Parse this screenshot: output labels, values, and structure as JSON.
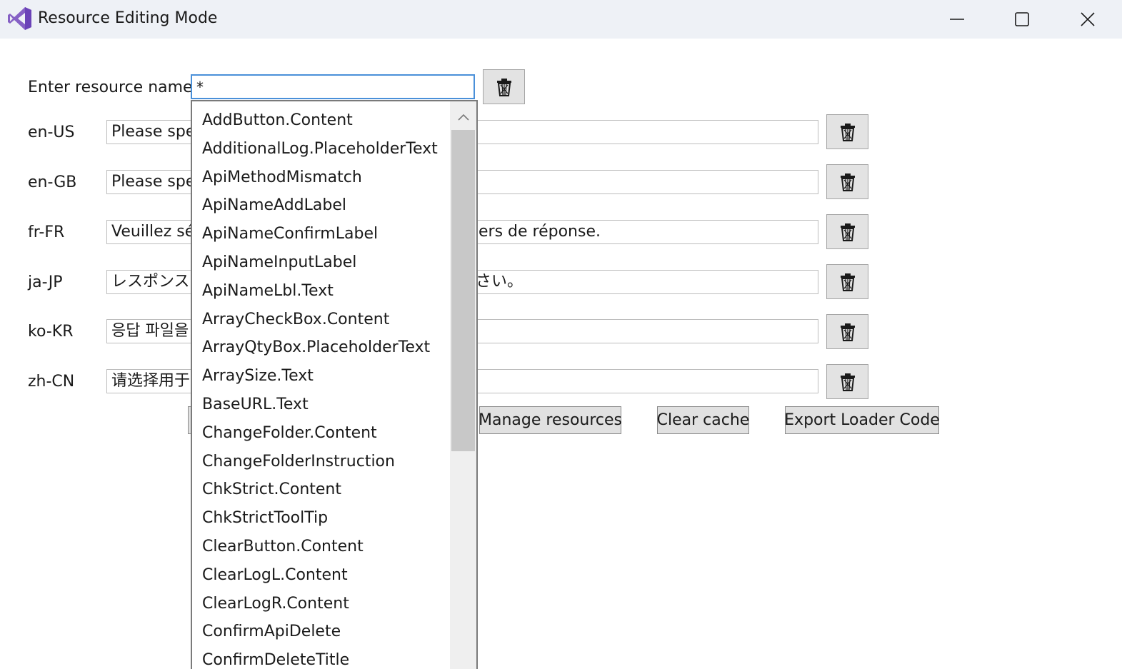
{
  "window": {
    "title": "Resource Editing Mode",
    "icons": {
      "app": "visual-studio-logo",
      "minimize": "minimize-icon",
      "maximize": "maximize-icon",
      "close": "close-icon"
    }
  },
  "form": {
    "resource_label": "Enter resource name",
    "resource_input_value": "*",
    "rows": [
      {
        "locale": "en-US",
        "left_text": "Please spe",
        "right_text": ""
      },
      {
        "locale": "en-GB",
        "left_text": "Please spe",
        "right_text": ""
      },
      {
        "locale": "fr-FR",
        "left_text": "Veuillez sé",
        "right_text": "ers de réponse."
      },
      {
        "locale": "ja-JP",
        "left_text": "レスポンスフ",
        "right_text": "さい。"
      },
      {
        "locale": "ko-KR",
        "left_text": "응답 파일을",
        "right_text": ""
      },
      {
        "locale": "zh-CN",
        "left_text": "请选择用于",
        "right_text": ""
      }
    ]
  },
  "actions": {
    "manage": "Manage resources",
    "clear_cache": "Clear cache",
    "export": "Export Loader Code"
  },
  "dropdown": {
    "items": [
      "AddButton.Content",
      "AdditionalLog.PlaceholderText",
      "ApiMethodMismatch",
      "ApiNameAddLabel",
      "ApiNameConfirmLabel",
      "ApiNameInputLabel",
      "ApiNameLbl.Text",
      "ArrayCheckBox.Content",
      "ArrayQtyBox.PlaceholderText",
      "ArraySize.Text",
      "BaseURL.Text",
      "ChangeFolder.Content",
      "ChangeFolderInstruction",
      "ChkStrict.Content",
      "ChkStrictToolTip",
      "ClearButton.Content",
      "ClearLogL.Content",
      "ClearLogR.Content",
      "ConfirmApiDelete",
      "ConfirmDeleteTitle"
    ]
  },
  "colors": {
    "titlebar": "#eef1f6",
    "input_focus_border": "#4a90d9",
    "button_face": "#e1e1e1",
    "scroll_thumb": "#c8c8c8"
  }
}
